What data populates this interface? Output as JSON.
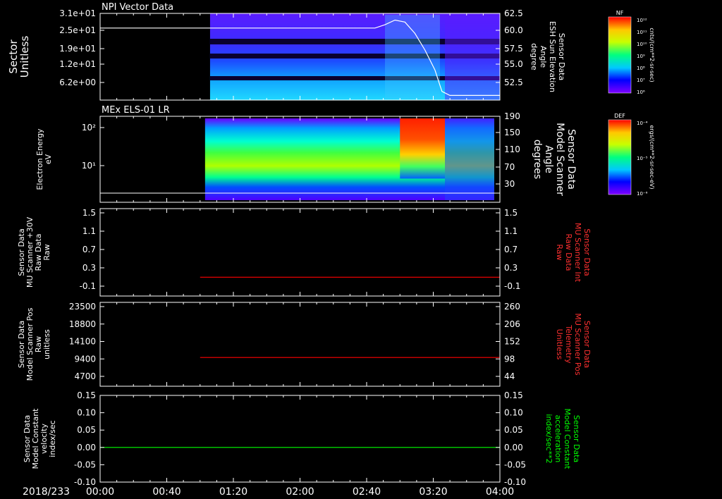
{
  "date_label": "2018/233",
  "time_ticks": [
    "00:00",
    "00:40",
    "01:20",
    "02:00",
    "02:40",
    "03:20",
    "04:00"
  ],
  "colors": {
    "red_trace": "#ff0000",
    "green_trace": "#00ff00",
    "white_trace": "#ffffff",
    "axis": "#ffffff"
  },
  "chart_data": [
    {
      "type": "heatmap",
      "title": "NPI Vector Data",
      "ylabel_lines": [
        "Sector",
        "Unitless"
      ],
      "y_ticks": [
        "3.1e+01",
        "2.5e+01",
        "1.9e+01",
        "1.2e+01",
        "6.2e+00"
      ],
      "right_label_lines": [
        "Sensor Data",
        "ESH Sun Elevation",
        "Angle",
        "degree"
      ],
      "right_ticks": [
        "62.5",
        "60.0",
        "57.5",
        "55.0",
        "52.5"
      ],
      "right_range": [
        50.5,
        63.5
      ],
      "overlay_line": {
        "t_hours": [
          0.0,
          1.1,
          2.0,
          2.75,
          2.85,
          2.95,
          3.05,
          3.15,
          3.25,
          3.35,
          3.42,
          3.5,
          4.0
        ],
        "values": [
          61.3,
          61.3,
          61.3,
          61.3,
          61.8,
          62.5,
          62.2,
          60.5,
          58.0,
          55.0,
          51.8,
          51.2,
          51.2
        ]
      },
      "data_start_hour": 1.1,
      "colorbar": {
        "label": "NF",
        "units": "cnts/(cm**2-sr-sec)",
        "ticks": [
          "10¹²",
          "10¹¹",
          "10¹⁰",
          "10⁹",
          "10⁸",
          "10⁷",
          "10⁶"
        ]
      }
    },
    {
      "type": "heatmap",
      "title": "MEx ELS-01 LR",
      "ylabel_lines": [
        "Electron Energy",
        "eV"
      ],
      "y_ticks": [
        "10²",
        "10¹"
      ],
      "right_label_lines": [
        "Sensor Data",
        "Model Scanner",
        "Angle",
        "degrees"
      ],
      "right_ticks": [
        "190",
        "150",
        "110",
        "70",
        "30"
      ],
      "data_start_hour": 1.05,
      "hot_region_hours": [
        3.0,
        3.45
      ],
      "colorbar": {
        "label": "DEF",
        "units": "ergs/(cm**2-sr-sec-eV)",
        "ticks": [
          "10⁻⁴",
          "10⁻⁵",
          "10⁻⁶"
        ]
      }
    },
    {
      "type": "line",
      "ylabel_lines": [
        "Sensor Data",
        "MU Scanner +30V",
        "Raw Data",
        "Raw"
      ],
      "y_ticks": [
        "1.5",
        "1.1",
        "0.7",
        "0.3",
        "-0.1"
      ],
      "ylim": [
        -0.5,
        1.5
      ],
      "right_label_lines": [
        "Sensor Data",
        "MU Scanner Int",
        "Raw Data",
        "Raw"
      ],
      "right_ticks": [
        "1.5",
        "1.1",
        "0.7",
        "0.3",
        "-0.1"
      ],
      "series": [
        {
          "t_hours": [
            1.0,
            4.0
          ],
          "values": [
            -0.07,
            -0.07
          ],
          "color": "#ff0000"
        }
      ]
    },
    {
      "type": "line",
      "ylabel_lines": [
        "Sensor Data",
        "Model Scanner Pos",
        "Raw",
        "unitless"
      ],
      "y_ticks": [
        "23500",
        "18800",
        "14100",
        "9400",
        "4700"
      ],
      "ylim": [
        0,
        23500
      ],
      "right_label_lines": [
        "Sensor Data",
        "MU Scanner Pos",
        "Telemetry",
        "Unitless"
      ],
      "right_ticks": [
        "260",
        "206",
        "152",
        "98",
        "44"
      ],
      "series": [
        {
          "t_hours": [
            1.0,
            4.0
          ],
          "values": [
            8050,
            8050
          ],
          "color": "#ff0000"
        }
      ]
    },
    {
      "type": "line",
      "ylabel_lines": [
        "Sensor Data",
        "Model Constant",
        "velocity",
        "index/sec"
      ],
      "y_ticks": [
        "0.15",
        "0.10",
        "0.05",
        "0.00",
        "-0.05",
        "-0.10"
      ],
      "ylim": [
        -0.1,
        0.15
      ],
      "right_label_lines": [
        "Sensor Data",
        "Model Constant",
        "acceleration",
        "index/sec**2"
      ],
      "right_ticks": [
        "0.15",
        "0.10",
        "0.05",
        "0.00",
        "-0.05",
        "-0.10"
      ],
      "series": [
        {
          "t_hours": [
            0.0,
            4.0
          ],
          "values": [
            0.0,
            0.0
          ],
          "color": "#00ff00"
        }
      ]
    }
  ]
}
